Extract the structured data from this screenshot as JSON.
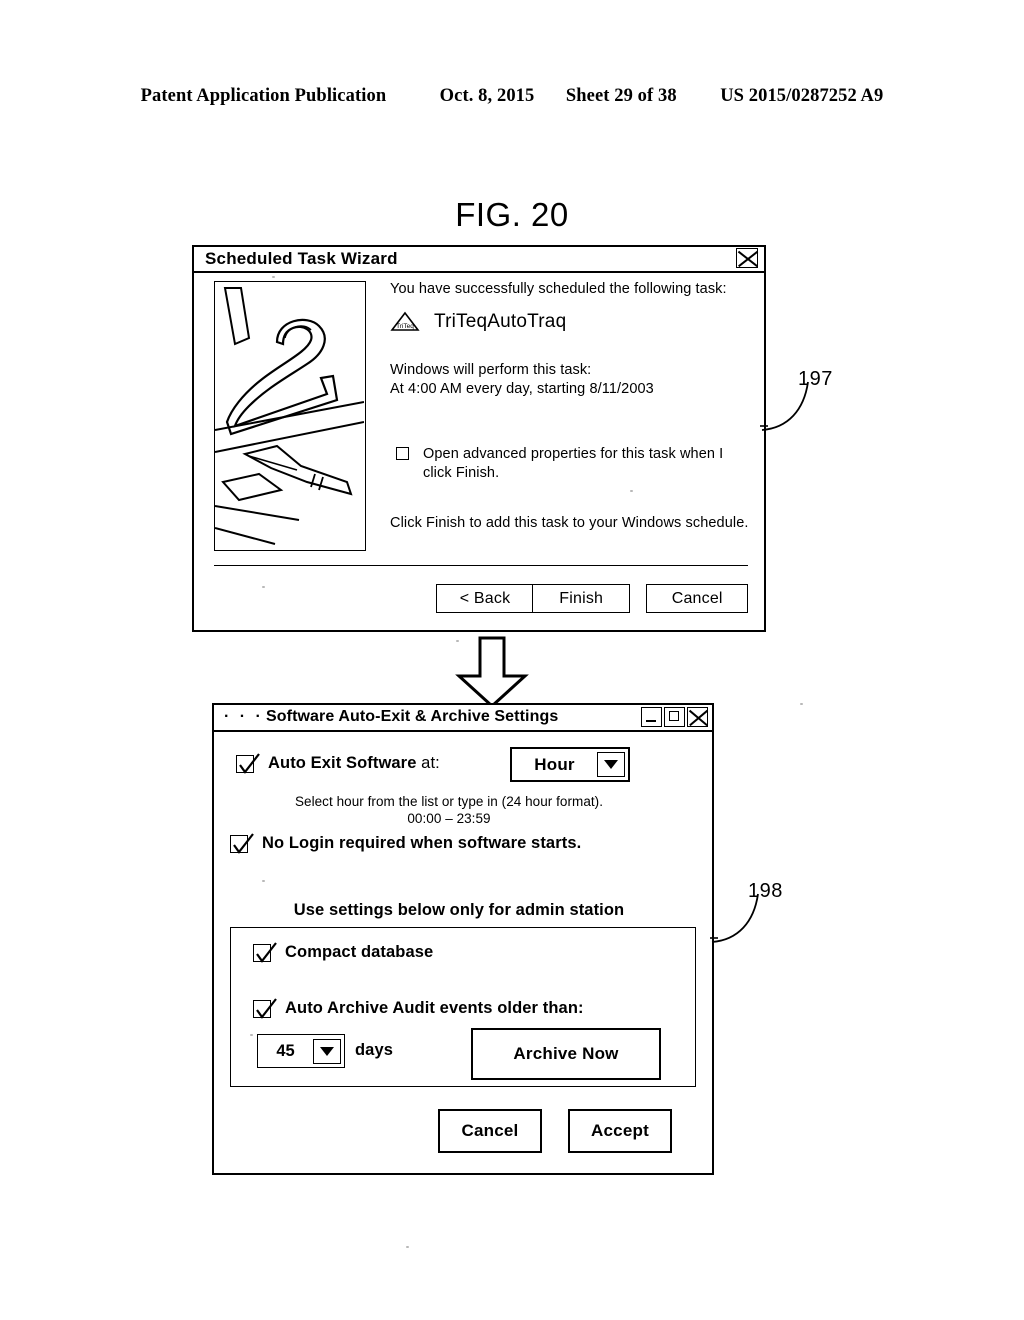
{
  "page_header": {
    "publication": "Patent Application Publication",
    "date": "Oct. 8, 2015",
    "sheet": "Sheet 29 of 38",
    "patent_number": "US 2015/0287252 A9"
  },
  "figure": {
    "label": "FIG. 20"
  },
  "dialog1": {
    "title": "Scheduled Task Wizard",
    "close_icon": "close-x-icon",
    "illustration": "calendar-page-with-pen-line-art",
    "intro_text": "You have successfully scheduled the following task:",
    "task_icon": "triteq-triangle-logo-icon",
    "task_name": "TriTeqAutoTraq",
    "perform_line1": "Windows will perform this task:",
    "perform_line2": "At 4:00 AM every day, starting 8/11/2003",
    "advanced_checkbox": {
      "checked": false,
      "label": "Open advanced properties for this task when I click Finish."
    },
    "final_text": "Click Finish to add this task to your Windows schedule.",
    "buttons": {
      "back": "< Back",
      "finish": "Finish",
      "cancel": "Cancel"
    }
  },
  "flow": {
    "arrow_icon": "down-block-arrow-icon"
  },
  "dialog2": {
    "title_dots": "· · · ·",
    "title": "Software Auto-Exit & Archive Settings",
    "window_buttons": {
      "minimize": "minimize-icon",
      "maximize": "maximize-icon",
      "close": "close-icon"
    },
    "auto_exit": {
      "checked": true,
      "label_bold": "Auto Exit Software",
      "label_thin": " at:"
    },
    "hour_combo": {
      "value": "Hour",
      "arrow_icon": "chevron-down-icon"
    },
    "hint_line1": "Select hour from the list or type in (24 hour format).",
    "hint_line2": "00:00 – 23:59",
    "no_login": {
      "checked": true,
      "label": "No Login required when software starts."
    },
    "admin_note": "Use settings below only for admin station",
    "compact_database": {
      "checked": true,
      "label": "Compact database"
    },
    "auto_archive": {
      "checked": true,
      "label": "Auto Archive Audit events older than:"
    },
    "days_combo": {
      "value": "45",
      "arrow_icon": "chevron-down-icon"
    },
    "days_label": "days",
    "archive_now_button": "Archive Now",
    "buttons": {
      "cancel": "Cancel",
      "accept": "Accept"
    }
  },
  "reference_numerals": {
    "upper": "197",
    "lower": "198"
  }
}
